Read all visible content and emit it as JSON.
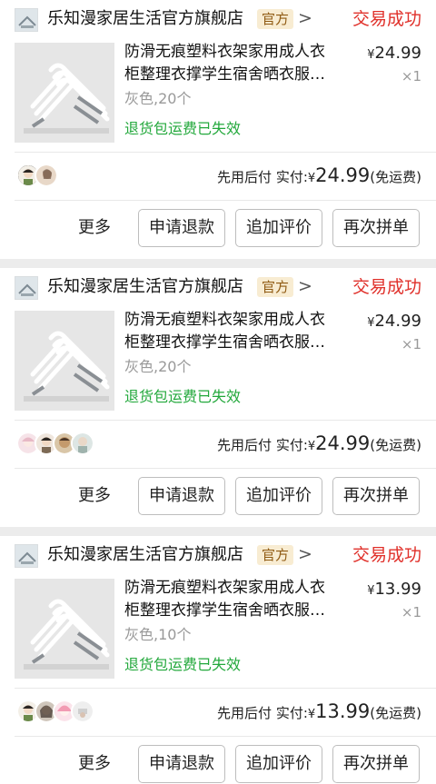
{
  "colors": {
    "status": "#e0302a",
    "notice": "#22a83b",
    "tag_bg": "#f8ecd2",
    "page_bg": "#ececec"
  },
  "orders": [
    {
      "shop_name": "乐知漫家居生活官方旗舰店",
      "shop_tag": "官方",
      "chevron": ">",
      "status": "交易成功",
      "title_line1": "防滑无痕塑料衣架家用成人衣",
      "title_line2": "柜整理衣撑学生宿舍晒衣服…",
      "currency": "¥",
      "price": "24.99",
      "qty": "×1",
      "spec": "灰色,20个",
      "notice": "退货包运费已失效",
      "pay_label": "先用后付 实付:",
      "pay_amount": "24.99",
      "shipping": "(免运费)",
      "buttons": {
        "more": "更多",
        "refund": "申请退款",
        "review": "追加评价",
        "rebuy": "再次拼单"
      },
      "avatar_count": 2
    },
    {
      "shop_name": "乐知漫家居生活官方旗舰店",
      "shop_tag": "官方",
      "chevron": ">",
      "status": "交易成功",
      "title_line1": "防滑无痕塑料衣架家用成人衣",
      "title_line2": "柜整理衣撑学生宿舍晒衣服…",
      "currency": "¥",
      "price": "24.99",
      "qty": "×1",
      "spec": "灰色,20个",
      "notice": "退货包运费已失效",
      "pay_label": "先用后付 实付:",
      "pay_amount": "24.99",
      "shipping": "(免运费)",
      "buttons": {
        "more": "更多",
        "refund": "申请退款",
        "review": "追加评价",
        "rebuy": "再次拼单"
      },
      "avatar_count": 4
    },
    {
      "shop_name": "乐知漫家居生活官方旗舰店",
      "shop_tag": "官方",
      "chevron": ">",
      "status": "交易成功",
      "title_line1": "防滑无痕塑料衣架家用成人衣",
      "title_line2": "柜整理衣撑学生宿舍晒衣服…",
      "currency": "¥",
      "price": "13.99",
      "qty": "×1",
      "spec": "灰色,10个",
      "notice": "退货包运费已失效",
      "pay_label": "先用后付 实付:",
      "pay_amount": "13.99",
      "shipping": "(免运费)",
      "buttons": {
        "more": "更多",
        "refund": "申请退款",
        "review": "追加评价",
        "rebuy": "再次拼单"
      },
      "avatar_count": 4
    }
  ]
}
